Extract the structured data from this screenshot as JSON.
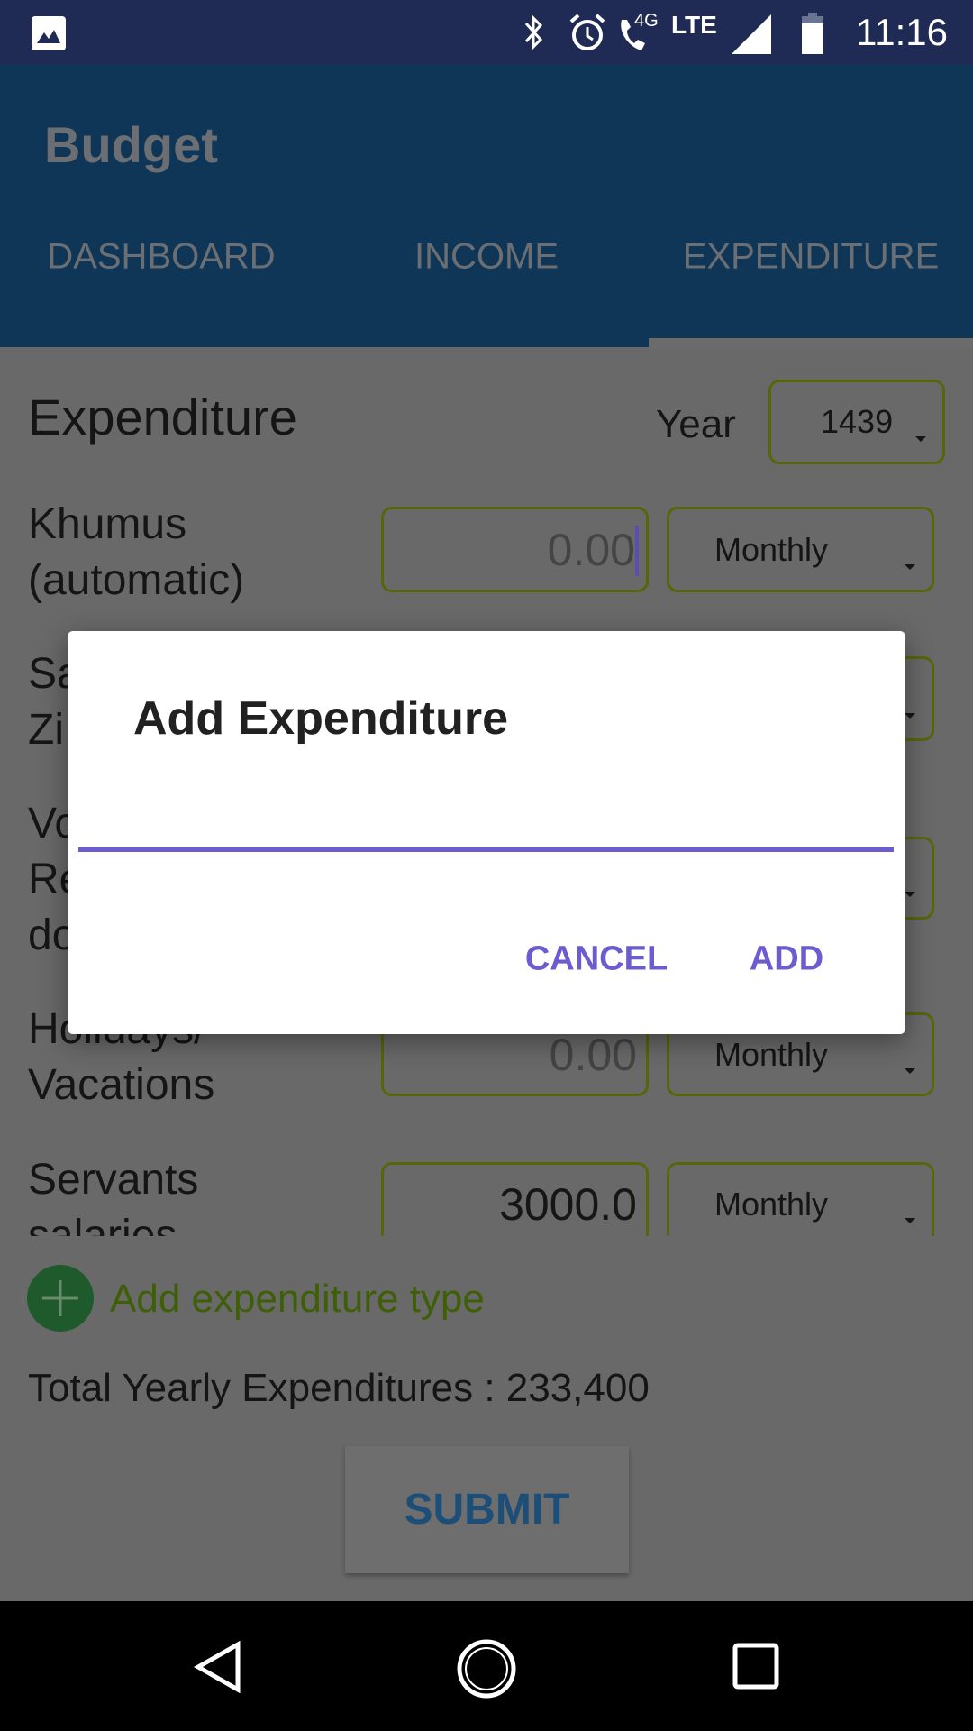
{
  "status_bar": {
    "time": "11:16",
    "network": "LTE",
    "call_badge": "4G",
    "icons": [
      "image-icon",
      "bluetooth-icon",
      "alarm-icon",
      "wifi-call-icon",
      "signal-icon",
      "battery-icon"
    ]
  },
  "app_bar": {
    "title": "Budget",
    "tabs": [
      {
        "label": "DASHBOARD"
      },
      {
        "label": "INCOME"
      },
      {
        "label": "EXPENDITURE",
        "selected": true
      }
    ]
  },
  "main": {
    "heading": "Expenditure",
    "year_label": "Year",
    "year_value": "1439",
    "rows": [
      {
        "label_lines": [
          "Khumus",
          "(automatic)"
        ],
        "amount": "0.00",
        "amount_is_hint": true,
        "period": "Monthly"
      },
      {
        "label_lines": [
          "Sa",
          "Zi"
        ]
      },
      {
        "label_lines": [
          "Vo",
          "Re",
          "do"
        ]
      },
      {
        "label_lines": [
          "Holidays/",
          "Vacations"
        ],
        "amount": "0.00",
        "amount_is_hint": true,
        "period": "Monthly"
      },
      {
        "label_lines": [
          "Servants",
          "salaries"
        ],
        "amount": "3000.0",
        "period": "Monthly"
      }
    ],
    "add_type_label": "Add expenditure type",
    "total": "Total Yearly Expenditures : 233,400",
    "submit": "SUBMIT"
  },
  "dialog": {
    "title": "Add Expenditure",
    "input_value": "",
    "cancel": "CANCEL",
    "add": "ADD",
    "accent": "#6b5ccf"
  },
  "colors": {
    "status_bar": "#1f2b55",
    "app_bar": "#0f3657",
    "scrim_bg": "#696969",
    "field_border": "#59650a"
  }
}
